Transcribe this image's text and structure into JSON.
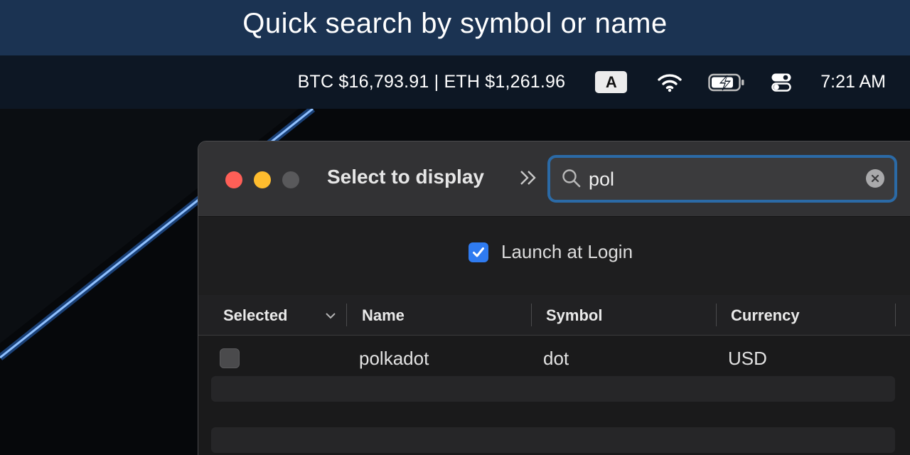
{
  "banner": {
    "text": "Quick search by symbol or name"
  },
  "menubar": {
    "ticker": "BTC $16,793.91 | ETH $1,261.96",
    "input_source": "A",
    "clock": "7:21 AM",
    "icons": [
      "wifi-icon",
      "battery-charging-icon",
      "control-center-icon"
    ]
  },
  "window": {
    "title": "Select to display",
    "search": {
      "value": "pol",
      "placeholder": ""
    },
    "launch_at_login": {
      "label": "Launch at Login",
      "checked": true
    },
    "table": {
      "columns": [
        "Selected",
        "Name",
        "Symbol",
        "Currency"
      ],
      "rows": [
        {
          "selected": false,
          "name": "polkadot",
          "symbol": "dot",
          "currency": "USD"
        }
      ]
    }
  },
  "colors": {
    "accent": "#2f7bf0",
    "focus_ring": "#2b6aa6",
    "banner": "#1b3352"
  }
}
